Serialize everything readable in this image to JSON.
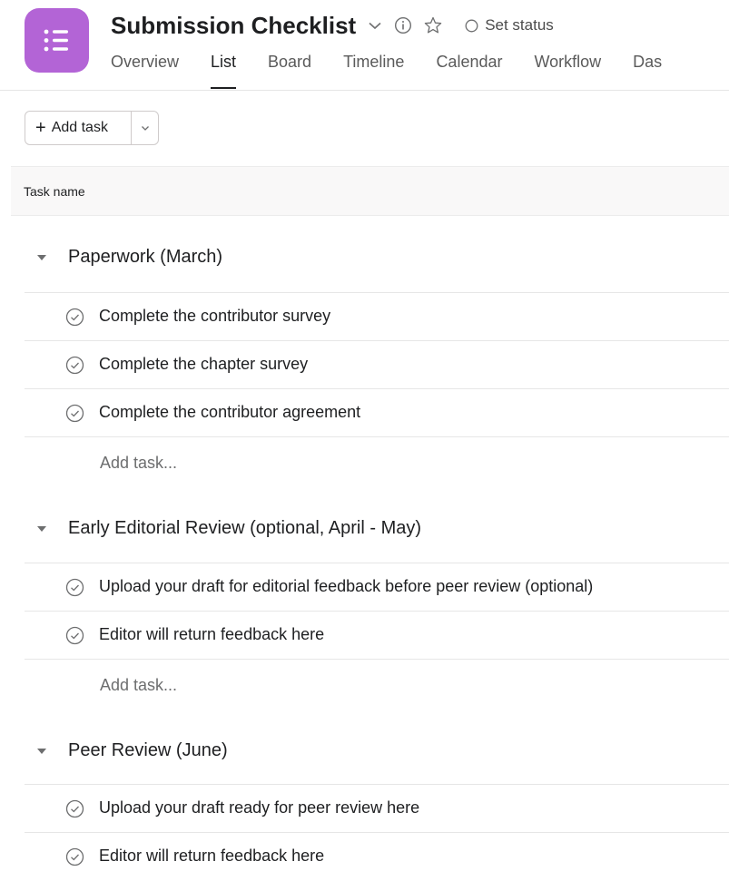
{
  "project": {
    "title": "Submission Checklist",
    "status_label": "Set status",
    "icon_color": "#b364d6"
  },
  "tabs": [
    {
      "label": "Overview"
    },
    {
      "label": "List"
    },
    {
      "label": "Board"
    },
    {
      "label": "Timeline"
    },
    {
      "label": "Calendar"
    },
    {
      "label": "Workflow"
    },
    {
      "label": "Das"
    }
  ],
  "toolbar": {
    "add_task_label": "Add task"
  },
  "columns": {
    "task_name": "Task name"
  },
  "sections": [
    {
      "title": "Paperwork (March)",
      "tasks": [
        {
          "name": "Complete the contributor survey"
        },
        {
          "name": "Complete the chapter survey"
        },
        {
          "name": "Complete the contributor agreement"
        }
      ],
      "add_task_label": "Add task..."
    },
    {
      "title": "Early Editorial Review (optional, April - May)",
      "tasks": [
        {
          "name": "Upload your draft for editorial feedback before peer review (optional)"
        },
        {
          "name": "Editor will return feedback here"
        }
      ],
      "add_task_label": "Add task..."
    },
    {
      "title": "Peer Review (June)",
      "tasks": [
        {
          "name": "Upload your draft ready for peer review here"
        },
        {
          "name": "Editor will return feedback here"
        }
      ]
    }
  ]
}
